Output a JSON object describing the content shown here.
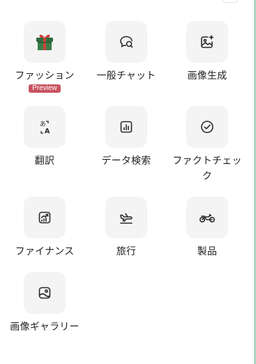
{
  "tools": [
    {
      "label": "ファッション",
      "badge": "Preview",
      "icon": "gift-box-icon"
    },
    {
      "label": "一般チャット",
      "icon": "chat-bubble-icon"
    },
    {
      "label": "画像生成",
      "icon": "image-sparkle-icon"
    },
    {
      "label": "翻訳",
      "icon": "translate-icon"
    },
    {
      "label": "データ検索",
      "icon": "bar-chart-icon"
    },
    {
      "label": "ファクトチェック",
      "icon": "check-circle-icon"
    },
    {
      "label": "ファイナンス",
      "icon": "finance-chart-icon"
    },
    {
      "label": "旅行",
      "icon": "airplane-icon"
    },
    {
      "label": "製品",
      "icon": "motorcycle-icon"
    },
    {
      "label": "画像ギャラリー",
      "icon": "image-gallery-icon"
    }
  ],
  "colors": {
    "tile_background": "#f4f4f4",
    "badge_background": "#c8545f",
    "edge_accent": "#3a9a6c",
    "gift_green": "#2f6b3e",
    "gift_red": "#c7453b"
  }
}
